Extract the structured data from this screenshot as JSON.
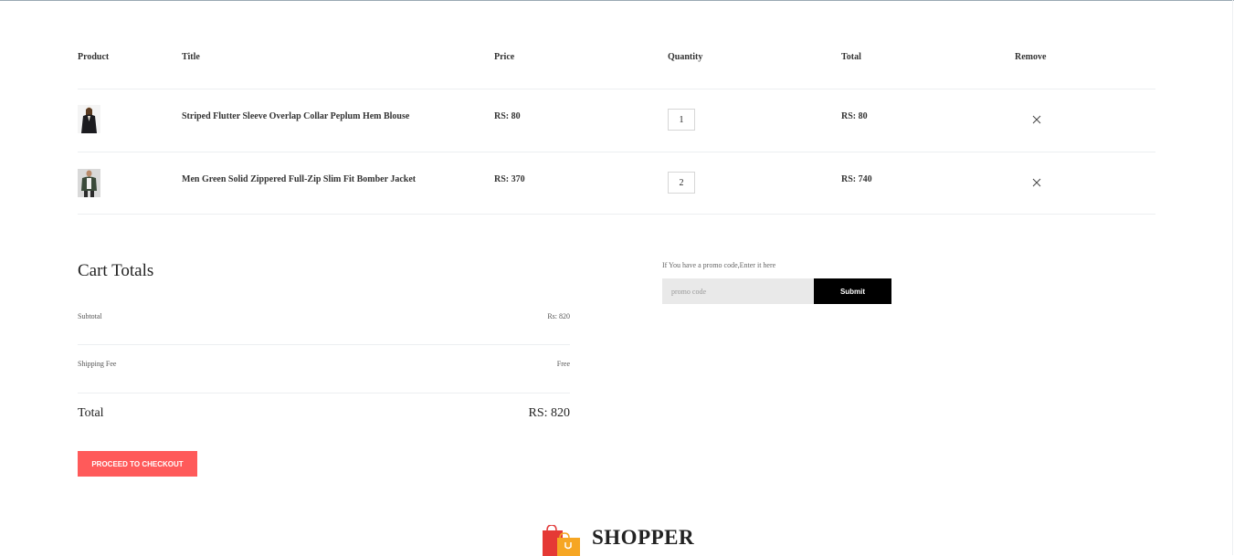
{
  "table": {
    "headers": {
      "product": "Product",
      "title": "Title",
      "price": "Price",
      "quantity": "Quantity",
      "total": "Total",
      "remove": "Remove"
    },
    "rows": [
      {
        "title": "Striped Flutter Sleeve Overlap Collar Peplum Hem Blouse",
        "price": "RS: 80",
        "quantity": "1",
        "total": "RS: 80"
      },
      {
        "title": "Men Green Solid Zippered Full-Zip Slim Fit Bomber Jacket",
        "price": "RS: 370",
        "quantity": "2",
        "total": "RS: 740"
      }
    ]
  },
  "cart_totals": {
    "title": "Cart Totals",
    "subtotal_label": "Subtotal",
    "subtotal_value": "Rs: 820",
    "shipping_label": "Shipping Fee",
    "shipping_value": "Free",
    "total_label": "Total",
    "total_value": "RS: 820",
    "checkout_label": "PROCEED TO CHECKOUT"
  },
  "promo": {
    "hint": "If You have a promo code,Enter it here",
    "placeholder": "promo code",
    "submit_label": "Submit"
  },
  "footer": {
    "brand": "SHOPPER"
  },
  "colors": {
    "checkout_button": "#ff5a5a",
    "submit_button": "#000000"
  },
  "icons": {
    "remove": "close-icon",
    "logo": "shopping-bags-icon"
  }
}
